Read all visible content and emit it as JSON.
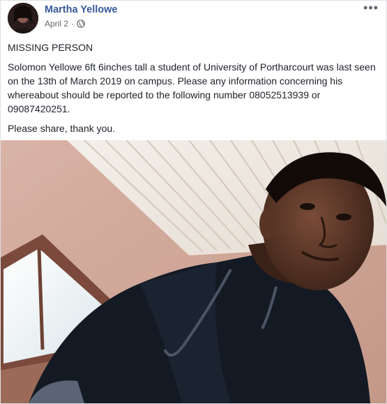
{
  "post": {
    "author": "Martha Yellowe",
    "date": "April 2",
    "separator": "·",
    "privacy_icon": "globe-icon",
    "more_icon": "more-options-icon",
    "more_label": "•••",
    "heading": "MISSING PERSON",
    "body": "Solomon Yellowe 6ft 6inches tall a student of University of Portharcourt was last seen on the 13th of March 2019 on campus. Please any information concerning his whereabout should be reported to the following number 08052513939 or 09087420251.",
    "closing": "Please share, thank you."
  },
  "colors": {
    "author": "#385898",
    "text": "#1d2129",
    "meta": "#616770",
    "border": "#dddfe2"
  }
}
